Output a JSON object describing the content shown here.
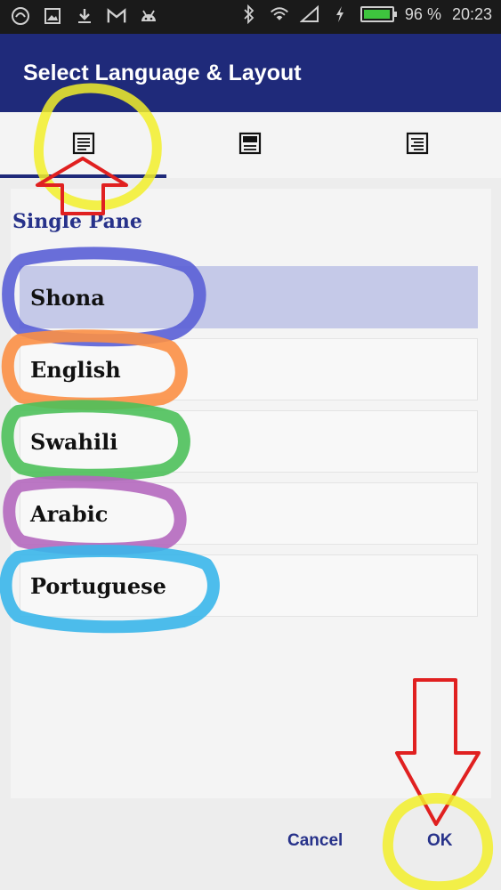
{
  "status_bar": {
    "battery_percent_text": "96 %",
    "battery_level": 0.96,
    "time": "20:23",
    "icons": [
      "app-logo-icon",
      "gallery-icon",
      "download-icon",
      "gmail-icon",
      "android-icon",
      "bluetooth-icon",
      "wifi-icon",
      "signal-icon",
      "charging-icon",
      "battery-icon"
    ]
  },
  "dialog": {
    "title": "Select Language & Layout",
    "tabs": [
      {
        "icon": "single-pane-icon",
        "active": true
      },
      {
        "icon": "two-pane-icon",
        "active": false
      },
      {
        "icon": "interlinear-icon",
        "active": false
      }
    ],
    "section_title": "Single Pane",
    "languages": [
      {
        "label": "Shona",
        "selected": true
      },
      {
        "label": "English",
        "selected": false
      },
      {
        "label": "Swahili",
        "selected": false
      },
      {
        "label": "Arabic",
        "selected": false
      },
      {
        "label": "Portuguese",
        "selected": false
      }
    ],
    "cancel_label": "Cancel",
    "ok_label": "OK"
  },
  "colors": {
    "app_bar": "#1f2a7a",
    "accent": "#27328a",
    "selected_row": "#c5c9e8",
    "highlight_yellow": "#f2ef2a",
    "arrow_red": "#e02020",
    "circle_blue": "#5a5fd6",
    "circle_orange": "#fb8f45",
    "circle_green": "#4dc05a",
    "circle_purple": "#b468be",
    "circle_cyan": "#3ab6ea"
  }
}
